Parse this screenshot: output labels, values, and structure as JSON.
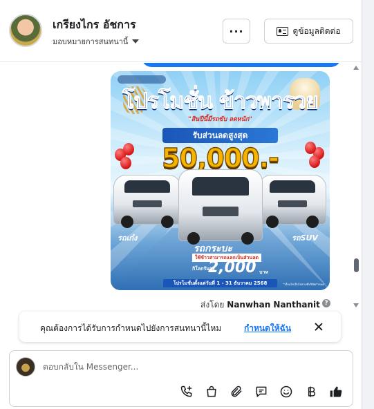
{
  "header": {
    "contact_name": "เกรียงไกร อัชการ",
    "assign_label": "มอบหมายการสนทนานี้",
    "more_label": "···",
    "contact_info_label": "ดูข้อมูลติดต่อ"
  },
  "thread": {
    "promo": {
      "headline": "โปรโมชั่น ข้าวพารวย",
      "subline": "\"สินปีนี้มีรถขับ ลดหนัก\"",
      "discount_label": "รับส่วนลดสูงสุด",
      "amount": "50,000.-",
      "label_left": "รถเก๋ง",
      "label_pickup": "รถกระบะ",
      "label_right": "รถSUV",
      "rate_note": "ใช้ข้าวสามารถแลกเป็นส่วนลด",
      "rate_prefix": "กิโลกรัมละ",
      "rate": "2,000",
      "rate_unit": "บาท",
      "period": "โปรโมชั่นตั้งแต่วันที่ 1 - 31 ธันวาคม 2568",
      "footnote": "*เงื่อนไขเป็นไปตามที่บริษัทกำหนด"
    },
    "sent_by_prefix": "ส่งโดย",
    "sender_name": "Nanwhan Nanthanit",
    "info_icon": "?"
  },
  "assign_banner": {
    "question": "คุณต้องการได้รับการกำหนดไปยังการสนทนานี้ไหม",
    "link_label": "กำหนดให้ฉัน"
  },
  "composer": {
    "placeholder": "ตอบกลับใน Messenger...",
    "tools": [
      "add-call-icon",
      "shopping-bag-icon",
      "attachment-icon",
      "saved-replies-icon",
      "emoji-icon",
      "baht-icon",
      "thumbs-up-icon"
    ]
  },
  "colors": {
    "accent": "#1877f2",
    "text": "#1c1e21",
    "border": "#ccd0d5"
  }
}
